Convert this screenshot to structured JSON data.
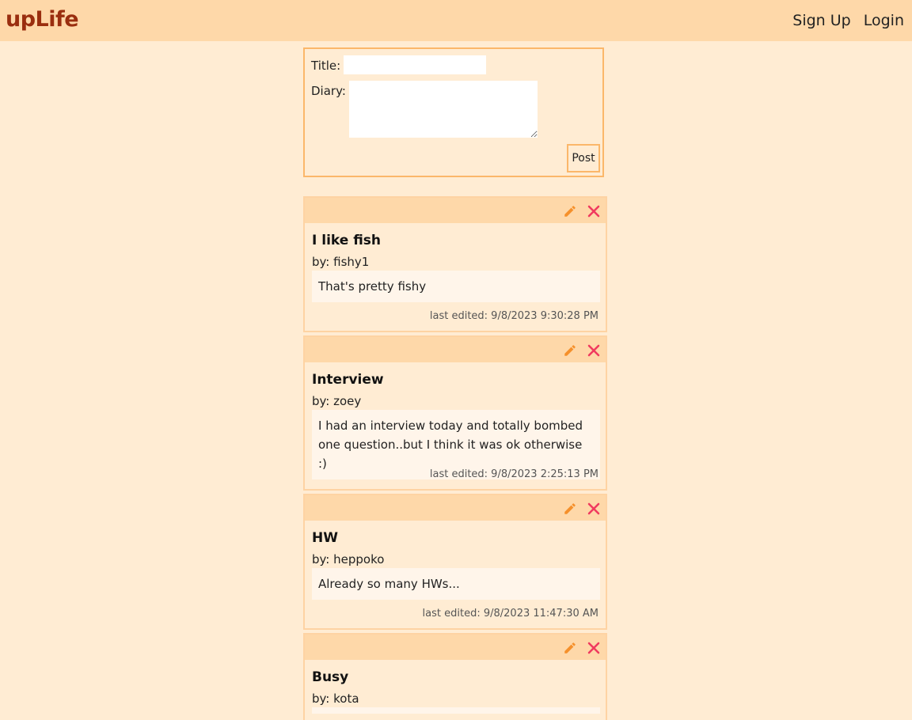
{
  "header": {
    "logo": "upLife",
    "nav": {
      "signup": "Sign Up",
      "login": "Login"
    }
  },
  "composer": {
    "title_label": "Title:",
    "title_value": "",
    "diary_label": "Diary:",
    "diary_value": "",
    "post_label": "Post"
  },
  "icons": {
    "edit": "pencil-icon",
    "delete": "close-icon"
  },
  "colors": {
    "edit_icon": "#f5902b",
    "delete_icon": "#f03a5f",
    "logo": "#9a2e0f",
    "header_bg": "#fed8a9",
    "page_bg": "#ffecd3"
  },
  "posts": [
    {
      "title": "I like fish",
      "author": "by: fishy1",
      "body": "That's pretty fishy",
      "edited": "last edited: 9/8/2023 9:30:28 PM"
    },
    {
      "title": "Interview",
      "author": "by: zoey",
      "body": "I had an interview today and totally bombed one question..but I think it was ok otherwise :)",
      "edited": "last edited: 9/8/2023 2:25:13 PM"
    },
    {
      "title": "HW",
      "author": "by: heppoko",
      "body": "Already so many HWs...",
      "edited": "last edited: 9/8/2023 11:47:30 AM"
    },
    {
      "title": "Busy",
      "author": "by: kota",
      "body": "",
      "edited": ""
    }
  ]
}
